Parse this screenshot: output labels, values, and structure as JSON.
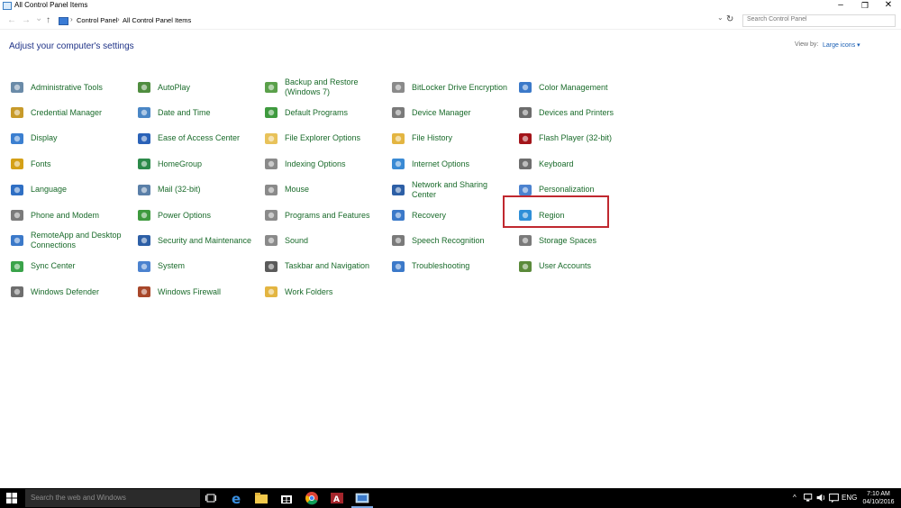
{
  "window": {
    "title": "All Control Panel Items",
    "minimize": "–",
    "restore": "❐",
    "close": "✕"
  },
  "address": {
    "back": "←",
    "forward": "→",
    "recent": "⌄",
    "up": "↑",
    "crumbs": [
      "Control Panel",
      "All Control Panel Items"
    ],
    "separator": "›",
    "dropdown": "⌄",
    "refresh": "↻",
    "search_placeholder": "Search Control Panel"
  },
  "heading": "Adjust your computer's settings",
  "view_by": {
    "label": "View by:",
    "value": "Large icons ▾"
  },
  "items": [
    {
      "label": "Administrative Tools",
      "icon": "tools-icon",
      "color": "#6a8ba8"
    },
    {
      "label": "AutoPlay",
      "icon": "autoplay-icon",
      "color": "#4f8d3f"
    },
    {
      "label": "Backup and Restore\n(Windows 7)",
      "icon": "backup-icon",
      "color": "#5aa04a"
    },
    {
      "label": "BitLocker Drive Encryption",
      "icon": "bitlocker-icon",
      "color": "#8a8a8a"
    },
    {
      "label": "Color Management",
      "icon": "color-management-icon",
      "color": "#3b79c9"
    },
    {
      "label": "Credential Manager",
      "icon": "credential-icon",
      "color": "#c79a2a"
    },
    {
      "label": "Date and Time",
      "icon": "clock-icon",
      "color": "#4a86c5"
    },
    {
      "label": "Default Programs",
      "icon": "default-programs-icon",
      "color": "#3e9a3e"
    },
    {
      "label": "Device Manager",
      "icon": "device-manager-icon",
      "color": "#7a7a7a"
    },
    {
      "label": "Devices and Printers",
      "icon": "printer-icon",
      "color": "#6c6c6c"
    },
    {
      "label": "Display",
      "icon": "display-icon",
      "color": "#3b7fd0"
    },
    {
      "label": "Ease of Access Center",
      "icon": "ease-of-access-icon",
      "color": "#2a62b8"
    },
    {
      "label": "File Explorer Options",
      "icon": "folder-icon",
      "color": "#e8c25a"
    },
    {
      "label": "File History",
      "icon": "file-history-icon",
      "color": "#e3b541"
    },
    {
      "label": "Flash Player (32-bit)",
      "icon": "flash-icon",
      "color": "#a3141a"
    },
    {
      "label": "Fonts",
      "icon": "fonts-icon",
      "color": "#d4a017"
    },
    {
      "label": "HomeGroup",
      "icon": "homegroup-icon",
      "color": "#2c8a4a"
    },
    {
      "label": "Indexing Options",
      "icon": "indexing-icon",
      "color": "#8a8a8a"
    },
    {
      "label": "Internet Options",
      "icon": "internet-icon",
      "color": "#3a8ad4"
    },
    {
      "label": "Keyboard",
      "icon": "keyboard-icon",
      "color": "#6e6e6e"
    },
    {
      "label": "Language",
      "icon": "language-icon",
      "color": "#2f6fc4"
    },
    {
      "label": "Mail (32-bit)",
      "icon": "mail-icon",
      "color": "#5a7fa8"
    },
    {
      "label": "Mouse",
      "icon": "mouse-icon",
      "color": "#8a8a8a"
    },
    {
      "label": "Network and Sharing\nCenter",
      "icon": "network-icon",
      "color": "#2d5fa6"
    },
    {
      "label": "Personalization",
      "icon": "personalization-icon",
      "color": "#4b82cf"
    },
    {
      "label": "Phone and Modem",
      "icon": "phone-icon",
      "color": "#7b7b7b"
    },
    {
      "label": "Power Options",
      "icon": "power-icon",
      "color": "#3e9a3e"
    },
    {
      "label": "Programs and Features",
      "icon": "programs-icon",
      "color": "#8a8a8a"
    },
    {
      "label": "Recovery",
      "icon": "recovery-icon",
      "color": "#3b79c9"
    },
    {
      "label": "Region",
      "icon": "globe-icon",
      "color": "#2f8fd8"
    },
    {
      "label": "RemoteApp and Desktop\nConnections",
      "icon": "remoteapp-icon",
      "color": "#3b79c9"
    },
    {
      "label": "Security and Maintenance",
      "icon": "flag-icon",
      "color": "#2d5fa6"
    },
    {
      "label": "Sound",
      "icon": "sound-icon",
      "color": "#8a8a8a"
    },
    {
      "label": "Speech Recognition",
      "icon": "microphone-icon",
      "color": "#7a7a7a"
    },
    {
      "label": "Storage Spaces",
      "icon": "storage-icon",
      "color": "#7a7a7a"
    },
    {
      "label": "Sync Center",
      "icon": "sync-icon",
      "color": "#3aa34a"
    },
    {
      "label": "System",
      "icon": "system-icon",
      "color": "#4b82cf"
    },
    {
      "label": "Taskbar and Navigation",
      "icon": "taskbar-icon",
      "color": "#5a5a5a"
    },
    {
      "label": "Troubleshooting",
      "icon": "troubleshoot-icon",
      "color": "#3b79c9"
    },
    {
      "label": "User Accounts",
      "icon": "user-accounts-icon",
      "color": "#5a8a3a"
    },
    {
      "label": "Windows Defender",
      "icon": "defender-icon",
      "color": "#6e6e6e"
    },
    {
      "label": "Windows Firewall",
      "icon": "firewall-icon",
      "color": "#a8472a"
    },
    {
      "label": "Work Folders",
      "icon": "work-folders-icon",
      "color": "#e3b541"
    }
  ],
  "taskbar": {
    "search_placeholder": "Search the web and Windows",
    "tray_arrow": "^",
    "language": "ENG",
    "time": "7:10 AM",
    "date": "04/10/2016"
  }
}
